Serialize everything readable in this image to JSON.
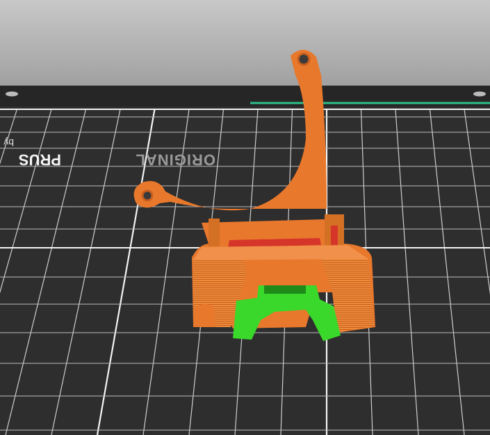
{
  "viewport": {
    "label": "3D preview of sliced part on print bed"
  },
  "bed": {
    "logo_line1": "ORIGINAL",
    "logo_line2": "PRUS",
    "logo_by": "by"
  },
  "colors": {
    "background_top": "#c4c4c4",
    "background_bottom": "#9e9e9e",
    "bed": "#2e2e2e",
    "grid": "#e8e8e8",
    "part": "#e8782c",
    "part_shadow": "#c8601e",
    "part_inner": "#d6362a",
    "support": "#3ad82a",
    "accent_line": "#2fbf8a"
  }
}
